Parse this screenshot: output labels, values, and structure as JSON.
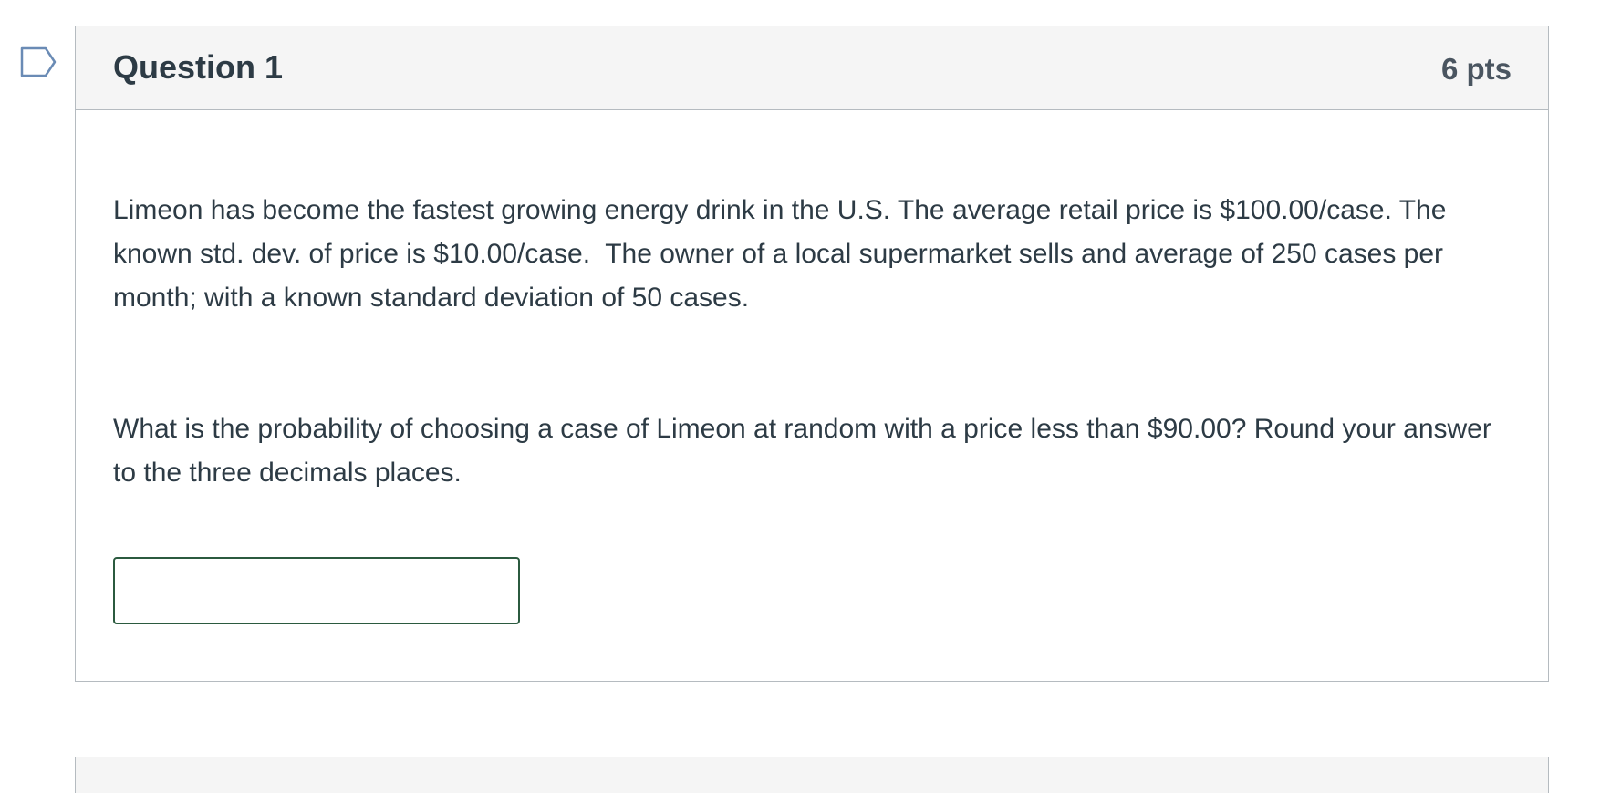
{
  "question": {
    "title": "Question 1",
    "points": "6 pts",
    "paragraphs": [
      "Limeon has become the fastest growing energy drink in the U.S. The average retail price is $100.00/case. The known std. dev. of price is $10.00/case.  The owner of a local supermarket sells and average of 250 cases per month; with a known standard deviation of 50 cases.",
      "What is the probability of choosing a case of Limeon at random with a price less than $90.00? Round your answer to the three decimals places."
    ],
    "answer": {
      "value": "",
      "placeholder": ""
    }
  },
  "colors": {
    "header_bg": "#f5f5f5",
    "border": "#b5bbc0",
    "input_border": "#2b5a3f",
    "flag_stroke": "#6a8bb5"
  },
  "icons": {
    "flag": "flag-question-icon"
  }
}
